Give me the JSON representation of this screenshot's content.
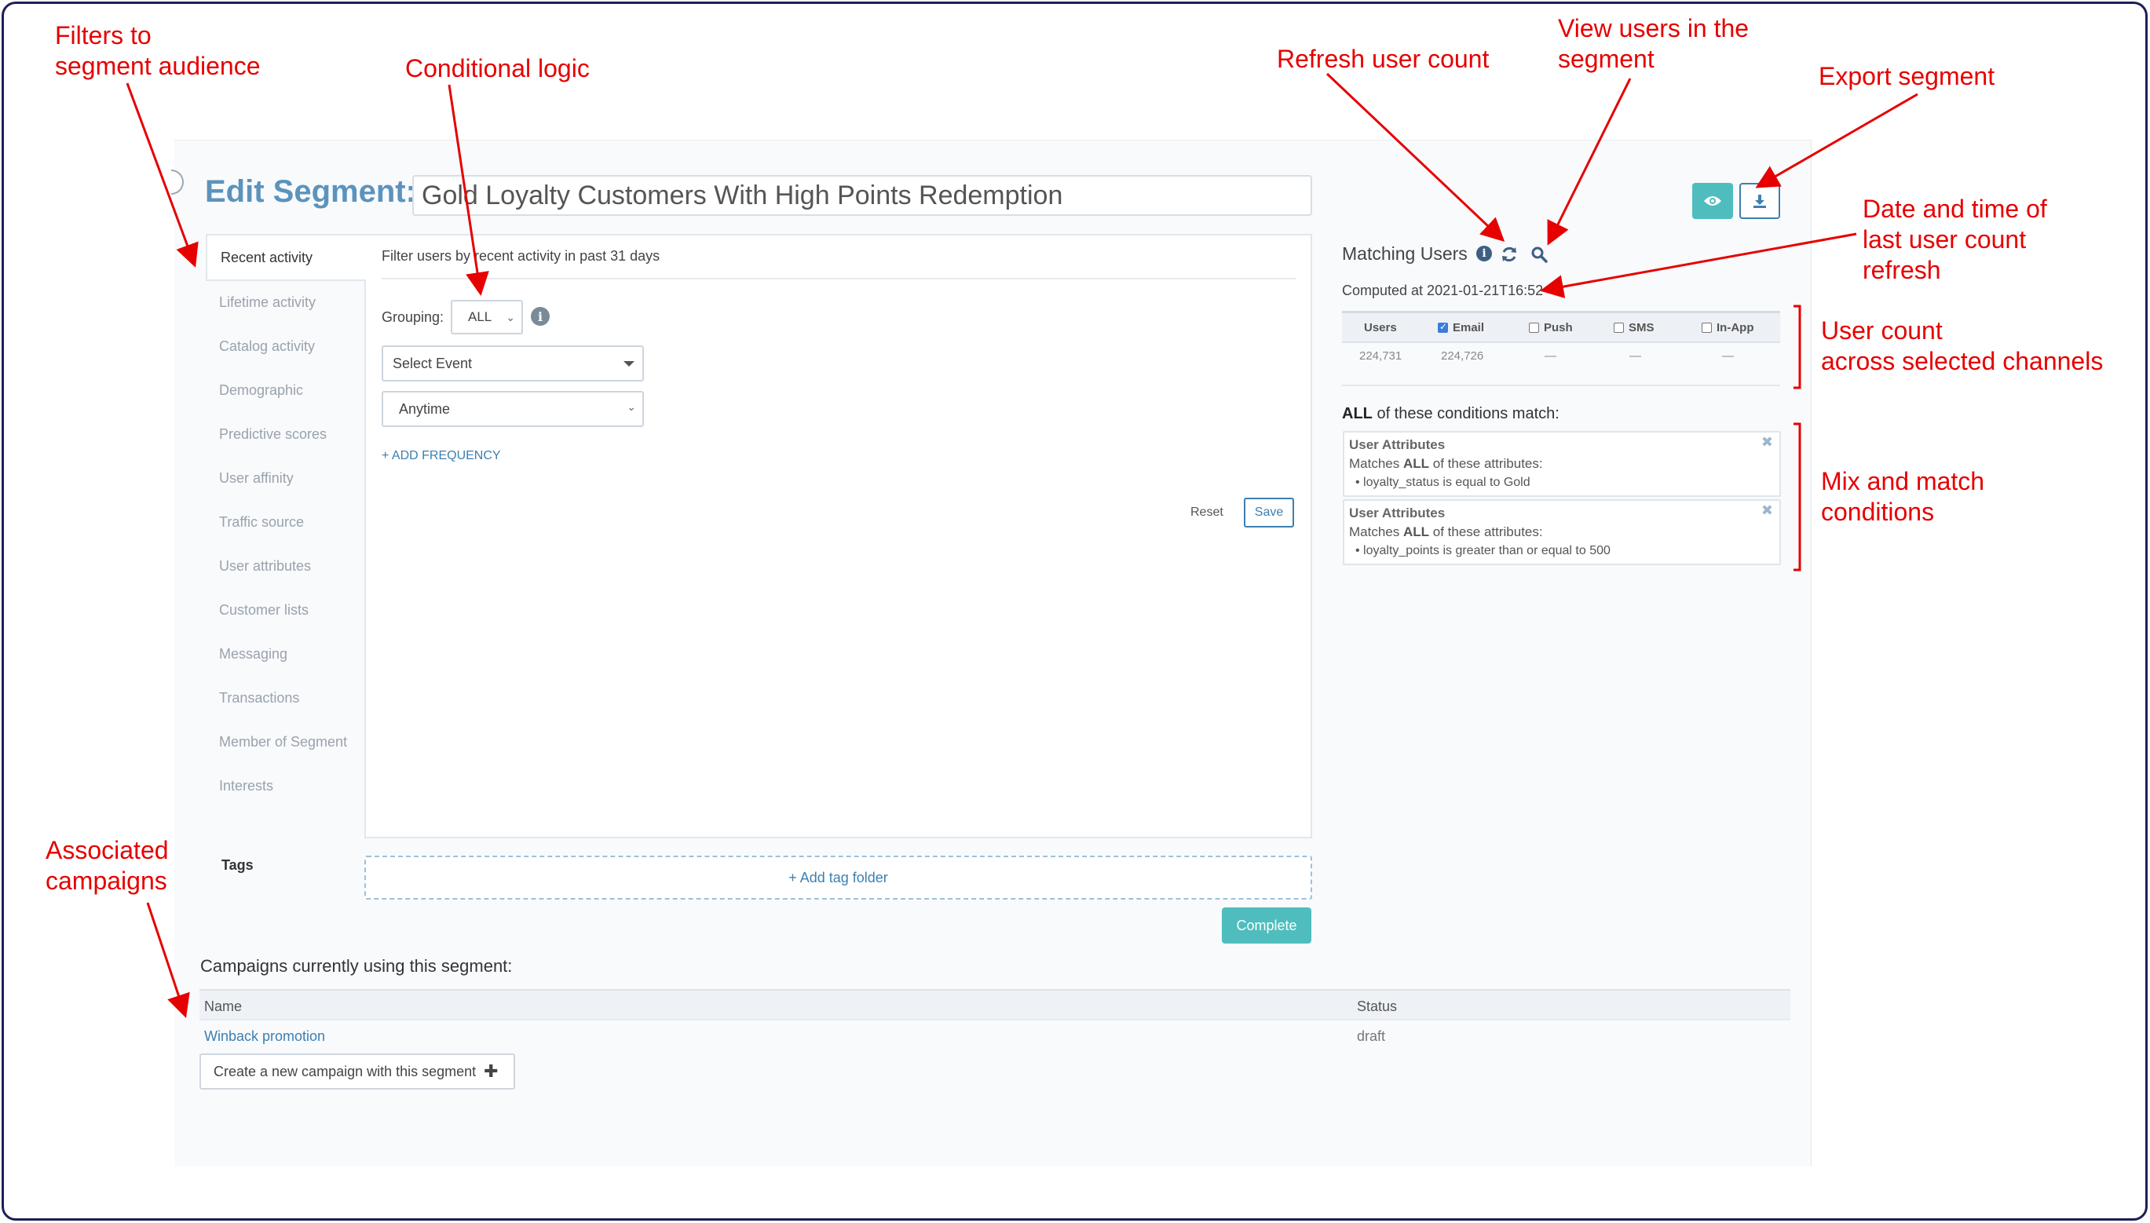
{
  "editor": {
    "title_label": "Edit Segment:",
    "segment_name": "Gold Loyalty Customers With High Points Redemption"
  },
  "filter_nav": [
    {
      "label": "Recent activity",
      "active": true
    },
    {
      "label": "Lifetime activity"
    },
    {
      "label": "Catalog activity"
    },
    {
      "label": "Demographic"
    },
    {
      "label": "Predictive scores"
    },
    {
      "label": "User affinity"
    },
    {
      "label": "Traffic source"
    },
    {
      "label": "User attributes"
    },
    {
      "label": "Customer lists"
    },
    {
      "label": "Messaging"
    },
    {
      "label": "Transactions"
    },
    {
      "label": "Member of Segment"
    },
    {
      "label": "Interests"
    }
  ],
  "filter_panel": {
    "heading": "Filter users by recent activity in past 31 days",
    "grouping_label": "Grouping:",
    "grouping_value": "ALL",
    "event_select": "Select Event",
    "time_select": "Anytime",
    "add_frequency": "+ ADD FREQUENCY",
    "reset": "Reset",
    "save": "Save"
  },
  "tags": {
    "label": "Tags",
    "add_folder": "+ Add tag folder"
  },
  "complete_label": "Complete",
  "campaigns": {
    "title": "Campaigns currently using this segment:",
    "columns": [
      "Name",
      "Status"
    ],
    "rows": [
      {
        "name": "Winback promotion",
        "status": "draft"
      }
    ],
    "create_button": "Create a new campaign with this segment"
  },
  "matching": {
    "title": "Matching Users",
    "computed": "Computed at 2021-01-21T16:52",
    "headers": [
      "Users",
      "Email",
      "Push",
      "SMS",
      "In-App"
    ],
    "checked": [
      false,
      true,
      false,
      false,
      false
    ],
    "values": [
      "224,731",
      "224,726",
      "—",
      "—",
      "—"
    ]
  },
  "conditions": {
    "head_bold": "ALL",
    "head_rest": " of these conditions match:",
    "cards": [
      {
        "title": "User Attributes",
        "match_pre": "Matches ",
        "match_bold": "ALL",
        "match_post": " of these attributes:",
        "bullet": "• loyalty_status is equal to Gold"
      },
      {
        "title": "User Attributes",
        "match_pre": "Matches ",
        "match_bold": "ALL",
        "match_post": " of these attributes:",
        "bullet": "• loyalty_points is greater than or equal to 500"
      }
    ]
  },
  "annotations": {
    "filters": [
      "Filters to",
      "segment audience"
    ],
    "conditional": "Conditional logic",
    "refresh": "Refresh user count",
    "view_users": [
      "View users in the",
      "segment"
    ],
    "export": "Export segment",
    "date_time": [
      "Date and time of",
      "last user count",
      "refresh"
    ],
    "user_count": [
      "User count",
      "across selected channels"
    ],
    "mix_match": [
      "Mix and match",
      "conditions"
    ],
    "campaigns": [
      "Associated",
      "campaigns"
    ]
  },
  "colors": {
    "accent_teal": "#4fbdbd",
    "link_blue": "#3d7fb0",
    "title_blue": "#5b93bd",
    "annotation_red": "#e60000"
  },
  "icons": [
    "eye-icon",
    "download-icon",
    "info-icon",
    "refresh-icon",
    "search-icon",
    "close-icon",
    "plus-icon"
  ]
}
